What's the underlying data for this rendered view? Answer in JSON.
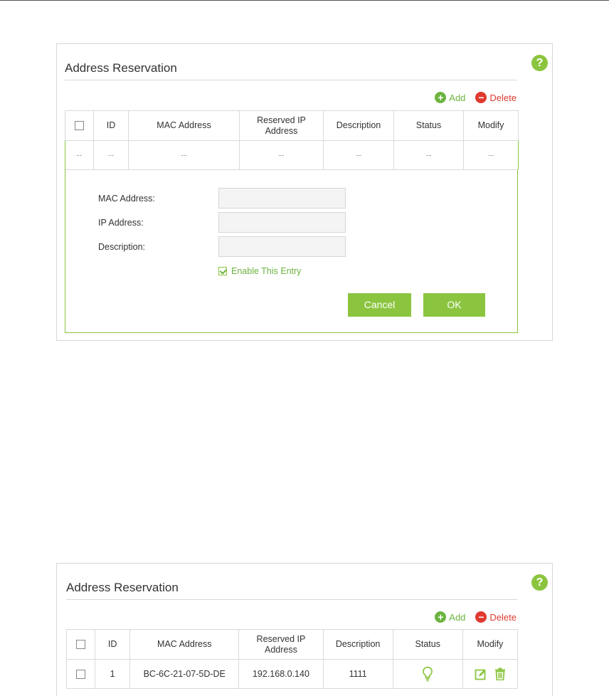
{
  "panel_top": {
    "title": "Address Reservation",
    "toolbar": {
      "add_label": "Add",
      "delete_label": "Delete"
    },
    "columns": [
      "ID",
      "MAC Address",
      "Reserved IP\nAddress",
      "Description",
      "Status",
      "Modify"
    ],
    "empty_row": [
      "--",
      "--",
      "--",
      "--",
      "--",
      "--",
      "--"
    ],
    "form": {
      "mac_label": "MAC Address:",
      "mac_value": "",
      "ip_label": "IP Address:",
      "ip_value": "",
      "description_label": "Description:",
      "description_value": "",
      "enable_label": "Enable This Entry",
      "enable_checked": true,
      "cancel_label": "Cancel",
      "ok_label": "OK"
    }
  },
  "panel_bottom": {
    "title": "Address Reservation",
    "toolbar": {
      "add_label": "Add",
      "delete_label": "Delete"
    },
    "columns": [
      "ID",
      "MAC Address",
      "Reserved IP\nAddress",
      "Description",
      "Status",
      "Modify"
    ],
    "rows": [
      {
        "id": "1",
        "mac": "BC-6C-21-07-5D-DE",
        "ip": "192.168.0.140",
        "description": "1111",
        "status_icon": "bulb-icon",
        "modify_icons": [
          "edit-icon",
          "trash-icon"
        ]
      }
    ]
  },
  "colors": {
    "accent": "#8bc53f",
    "add": "#6cb33f",
    "delete": "#e03a2f"
  },
  "icons": {
    "help": "?",
    "add": "+",
    "delete": "−"
  }
}
